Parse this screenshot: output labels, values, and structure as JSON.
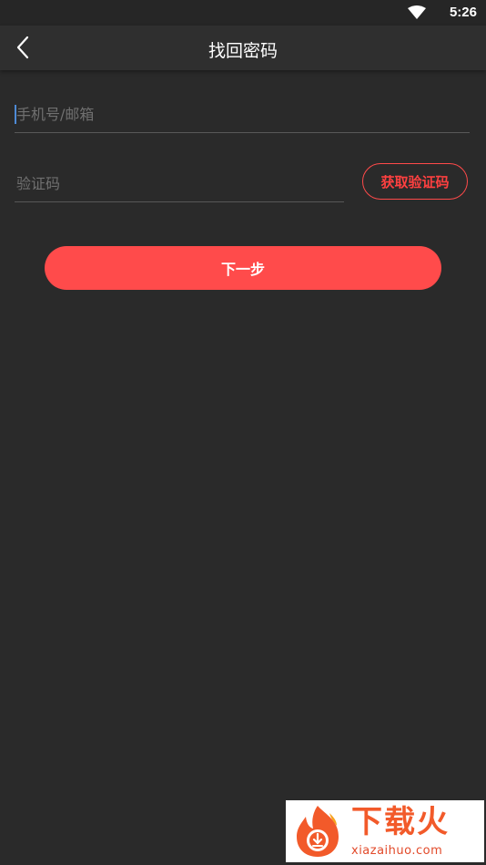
{
  "status_bar": {
    "time": "5:26",
    "wifi_icon": "wifi-icon"
  },
  "app_bar": {
    "title": "找回密码",
    "back_icon": "chevron-left-icon"
  },
  "form": {
    "phone_email": {
      "value": "",
      "placeholder": "手机号/邮箱"
    },
    "verification_code": {
      "value": "",
      "placeholder": "验证码"
    },
    "get_code_label": "获取验证码",
    "next_label": "下一步"
  },
  "watermark": {
    "brand": "下载火",
    "url": "xiazaihuo.com"
  },
  "colors": {
    "accent": "#ff4b4b",
    "background": "#2a2a2a",
    "appbar": "#2f2f2f",
    "caret": "#4d8ad6"
  }
}
